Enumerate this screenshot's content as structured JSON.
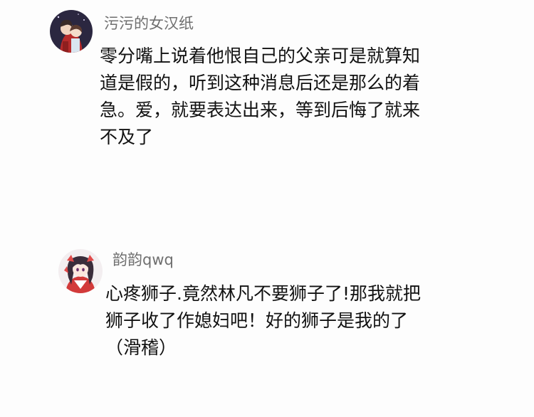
{
  "comments": [
    {
      "username": "污污的女汉纸",
      "avatar_icon": "anime-couple-avatar",
      "text": "零分嘴上说着他恨自己的父亲可是就算知\n道是假的，听到这种消息后还是那么的着\n急。爱，就要表达出来，等到后悔了就来\n不及了"
    },
    {
      "username": "韵韵qwq",
      "avatar_icon": "anime-girl-avatar",
      "text": "心疼狮子.竟然林凡不要狮子了!那我就把\n狮子收了作媳妇吧！好的狮子是我的了\n（滑稽）"
    }
  ],
  "colors": {
    "background": "#fdfdfd",
    "username": "#6f6f6f",
    "text": "#111111"
  }
}
